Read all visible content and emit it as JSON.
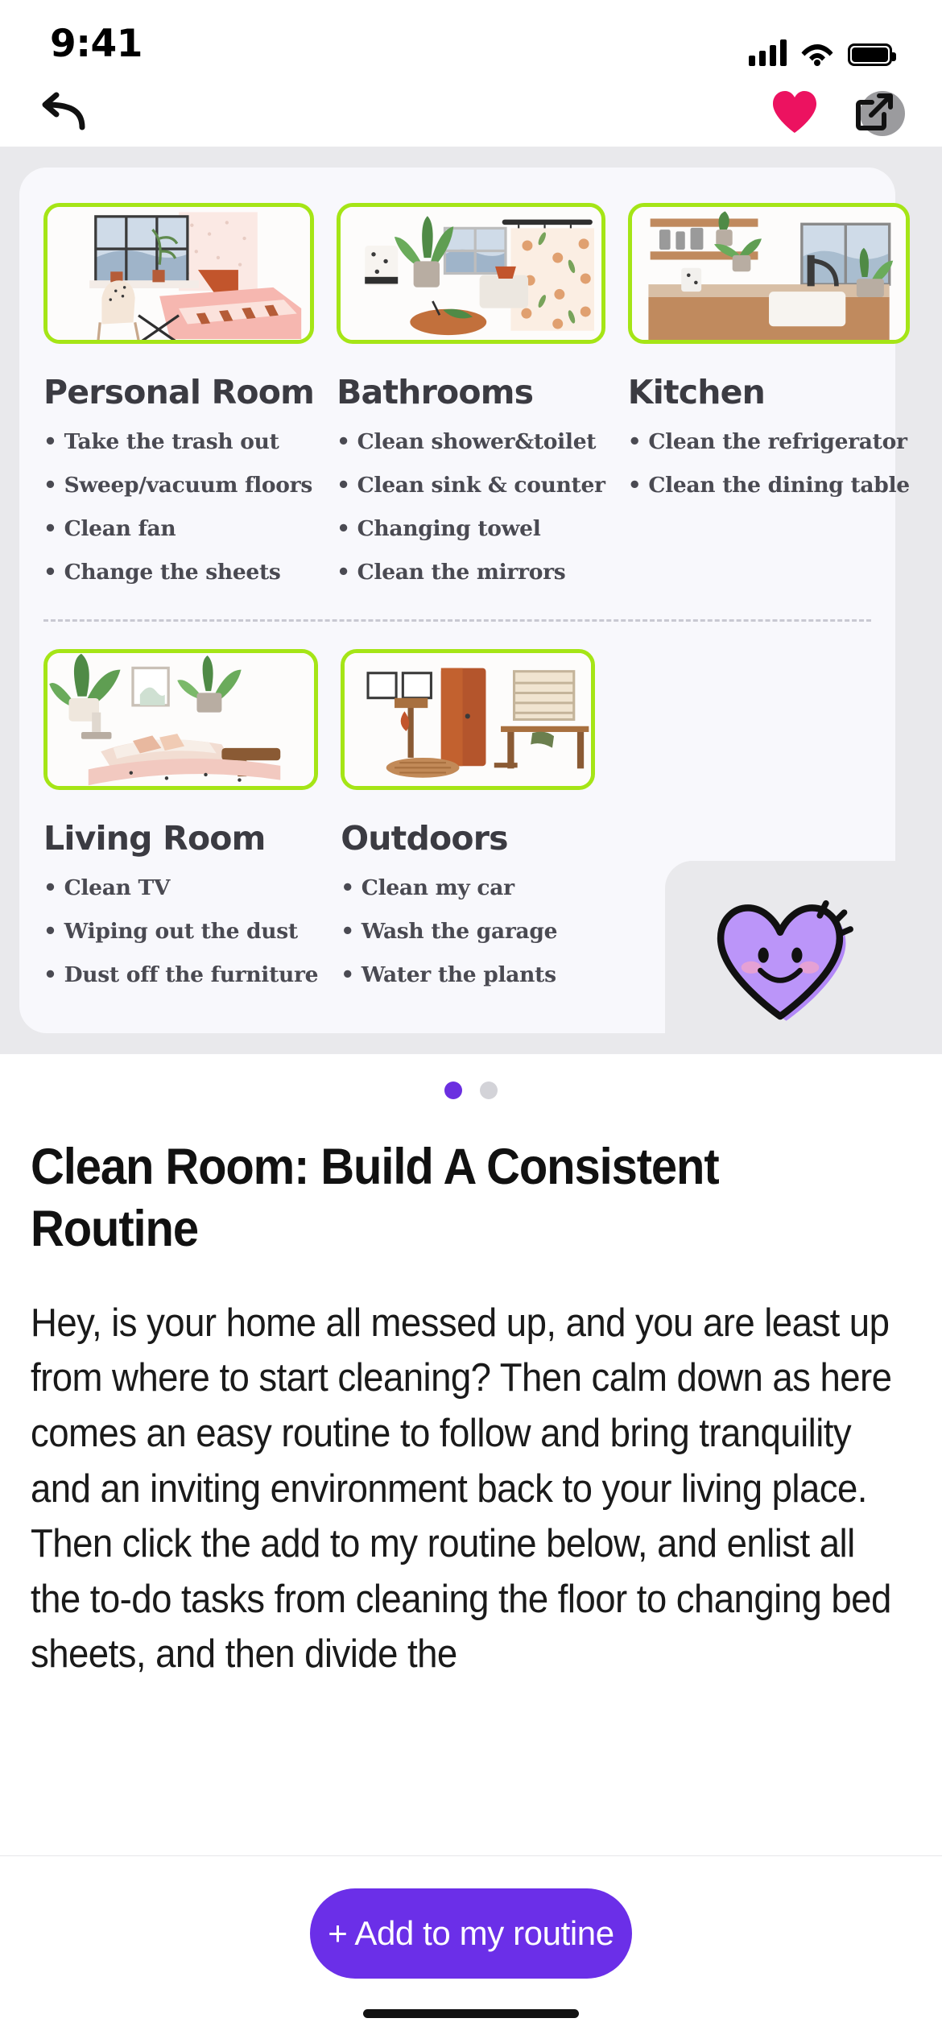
{
  "status_bar": {
    "time": "9:41",
    "signal_icon": "cellular-bars-icon",
    "wifi_icon": "wifi-icon",
    "battery_icon": "battery-full-icon"
  },
  "nav_bar": {
    "back_icon": "back-arrow-icon",
    "favorite_icon": "heart-filled-icon",
    "favorite_color": "#ec1260",
    "share_icon": "share-external-icon",
    "share_badge_color": "#9b9b9e"
  },
  "hero": {
    "card_background": "#f8f8fc",
    "page_background": "#e9e9ec",
    "thumb_border_color": "#a5e516",
    "mascot_icon": "smiling-heart-mascot-icon",
    "mascot_color": "#b288f7",
    "rooms": [
      {
        "title": "Personal Room",
        "image": "bedroom-illustration",
        "tasks": [
          "Take the trash out",
          "Sweep/vacuum floors",
          "Clean fan",
          "Change the sheets"
        ]
      },
      {
        "title": "Bathrooms",
        "image": "bathroom-illustration",
        "tasks": [
          "Clean shower&toilet",
          "Clean sink & counter",
          "Changing towel",
          "Clean the mirrors"
        ]
      },
      {
        "title": "Kitchen",
        "image": "kitchen-illustration",
        "tasks": [
          "Clean the refrigerator",
          "Clean the dining table"
        ]
      },
      {
        "title": "Living Room",
        "image": "living-room-illustration",
        "tasks": [
          "Clean TV",
          "Wiping out the dust",
          "Dust off the furniture"
        ]
      },
      {
        "title": "Outdoors",
        "image": "outdoors-illustration",
        "tasks": [
          "Clean my car",
          "Wash the garage",
          "Water the plants"
        ]
      }
    ]
  },
  "pagination": {
    "total": 2,
    "active_index": 0,
    "active_color": "#6b2fe0",
    "inactive_color": "#d3d3d8"
  },
  "article": {
    "title": "Clean Room: Build A Consistent Routine",
    "paragraph_1": "Hey, is your home all messed up, and you are least up from where to start cleaning? Then calm down as here comes an easy routine to follow and bring tranquility and an inviting environment back to your living place.",
    "paragraph_2": "Then click the add to my routine below, and enlist all the to-do tasks from cleaning the floor to changing bed sheets, and then divide the"
  },
  "footer": {
    "cta_label": "+ Add to my routine",
    "cta_color": "#6b2fe8"
  }
}
